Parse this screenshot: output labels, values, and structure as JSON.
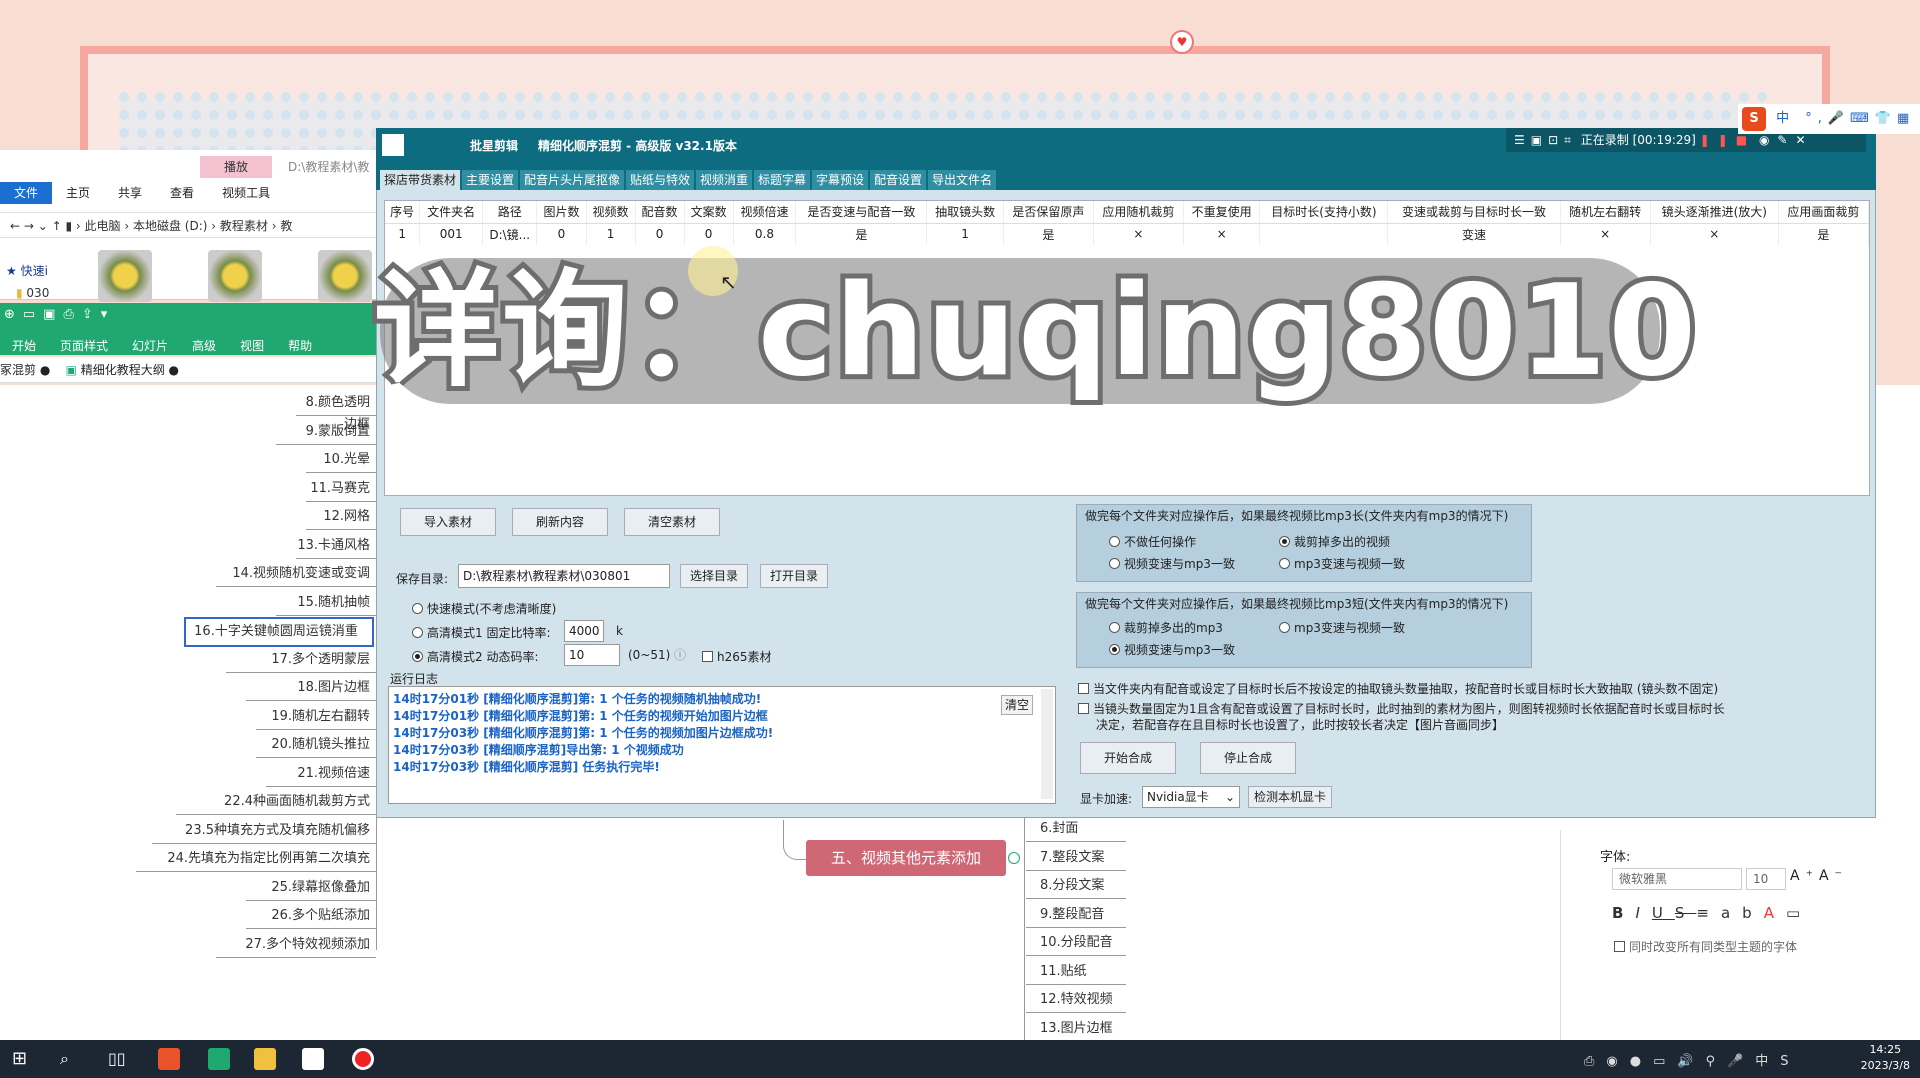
{
  "watermark": {
    "text": "详询：chuqing8010"
  },
  "window": {
    "app_name": "批星剪辑",
    "title": "精细化顺序混剪 - 高级版  v32.1版本",
    "tabs": [
      "探店带货素材",
      "主要设置",
      "配音片头片尾抠像",
      "贴纸与特效",
      "视频消重",
      "标题字幕",
      "字幕预设",
      "配音设置",
      "导出文件名"
    ]
  },
  "table": {
    "headers": [
      "序号",
      "文件夹名",
      "路径",
      "图片数",
      "视频数",
      "配音数",
      "文案数",
      "视频倍速",
      "是否变速与配音一致",
      "抽取镜头数",
      "是否保留原声",
      "应用随机裁剪",
      "不重复使用",
      "目标时长(支持小数)",
      "变速或裁剪与目标时长一致",
      "随机左右翻转",
      "镜头逐渐推进(放大)",
      "应用画面裁剪"
    ],
    "rows": [
      [
        "1",
        "001",
        "D:\\镜...",
        "0",
        "1",
        "0",
        "0",
        "0.8",
        "是",
        "1",
        "是",
        "×",
        "×",
        "",
        "变速",
        "×",
        "×",
        "是"
      ]
    ]
  },
  "buttons": {
    "import": "导入素材",
    "refresh": "刷新内容",
    "clear": "清空素材",
    "choose_dir": "选择目录",
    "open_dir": "打开目录",
    "start": "开始合成",
    "stop": "停止合成",
    "detect_gpu": "检测本机显卡",
    "log_clear": "清空"
  },
  "save": {
    "label": "保存目录:",
    "value": "D:\\教程素材\\教程素材\\030801"
  },
  "modes": {
    "fast": "快速模式(不考虑清晰度)",
    "hq1": "高清模式1 固定比特率:",
    "hq1_value": "4000",
    "hq1_unit": "k",
    "hq2": "高清模式2 动态码率:",
    "hq2_value": "10",
    "hq2_range": "(0~51)",
    "h265": "h265素材"
  },
  "log": {
    "label": "运行日志",
    "lines": [
      "14时17分01秒 [精细化顺序混剪]第: 1 个任务的视频随机抽帧成功!",
      "14时17分01秒 [精细化顺序混剪]第: 1 个任务的视频开始加图片边框",
      "14时17分03秒 [精细化顺序混剪]第: 1 个任务的视频加图片边框成功!",
      "14时17分03秒 [精细顺序混剪]导出第: 1 个视频成功",
      "14时17分03秒 [精细化顺序混剪] 任务执行完毕!"
    ]
  },
  "group1": {
    "title": "做完每个文件夹对应操作后，如果最终视频比mp3长(文件夹内有mp3的情况下)",
    "opts": [
      "不做任何操作",
      "裁剪掉多出的视频",
      "视频变速与mp3一致",
      "mp3变速与视频一致"
    ],
    "selected": 1
  },
  "group2": {
    "title": "做完每个文件夹对应操作后，如果最终视频比mp3短(文件夹内有mp3的情况下)",
    "opts": [
      "裁剪掉多出的mp3",
      "mp3变速与视频一致",
      "视频变速与mp3一致"
    ],
    "selected": 2
  },
  "checks": {
    "c1": "当文件夹内有配音或设定了目标时长后不按设定的抽取镜头数量抽取，按配音时长或目标时长大致抽取 (镜头数不固定)",
    "c2a": "当镜头数量固定为1且含有配音或设置了目标时长时，此时抽到的素材为图片，则图转视频时长依据配音时长或目标时长",
    "c2b": "决定，若配音存在且目标时长也设置了，此时按较长者决定【图片音画同步】"
  },
  "gpu": {
    "label": "显卡加速:",
    "value": "Nvidia显卡"
  },
  "recording": {
    "text": "正在录制 [00:19:29]"
  },
  "ime": {
    "logo": "S",
    "text": "中 °,"
  },
  "explorer": {
    "play_tab": "播放",
    "path_top": "D:\\教程素材\\教",
    "tabs": [
      "文件",
      "主页",
      "共享",
      "查看",
      "视频工具"
    ],
    "crumbs": [
      "此电脑",
      "本地磁盘 (D:)",
      "教程素材",
      "教"
    ],
    "quick": "快速i",
    "folder": "030"
  },
  "ribbon": {
    "menu": [
      "开始",
      "页面样式",
      "幻灯片",
      "高级",
      "视图",
      "帮助"
    ],
    "doc_tabs": [
      "冢混剪",
      "精细化教程大纲"
    ]
  },
  "mindmap": {
    "left": [
      "8.颜色透明边框",
      "9.蒙版倒置",
      "10.光晕",
      "11.马赛克",
      "12.网格",
      "13.卡通风格",
      "14.视频随机变速或变调",
      "15.随机抽帧",
      "16.十字关键帧圆周运镜消重",
      "17.多个透明蒙层",
      "18.图片边框",
      "19.随机左右翻转",
      "20.随机镜头推拉",
      "21.视频倍速",
      "22.4种画面随机裁剪方式",
      "23.5种填充方式及填充随机偏移",
      "24.先填充为指定比例再第二次填充",
      "25.绿幕抠像叠加",
      "26.多个贴纸添加",
      "27.多个特效视频添加"
    ],
    "node": "五、视频其他元素添加",
    "right": [
      "6.封面",
      "7.整段文案",
      "8.分段文案",
      "9.整段配音",
      "10.分段配音",
      "11.贴纸",
      "12.特效视频",
      "13.图片边框"
    ]
  },
  "font_panel": {
    "label": "字体:",
    "font": "微软雅黑",
    "size": "10",
    "check": "同时改变所有同类型主题的字体"
  },
  "taskbar": {
    "time": "14:25",
    "date": "2023/3/8"
  }
}
